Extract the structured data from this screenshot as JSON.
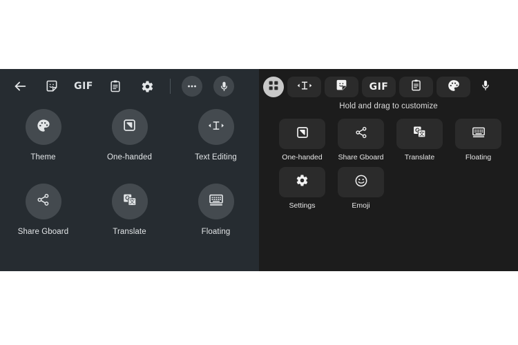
{
  "left_panel": {
    "background": "#262c31",
    "toolbar": {
      "items": [
        {
          "icon": "back-arrow-icon",
          "label": "Back"
        },
        {
          "icon": "sticker-icon",
          "label": "Stickers"
        },
        {
          "icon": "gif-icon",
          "label": "GIF"
        },
        {
          "icon": "clipboard-icon",
          "label": "Clipboard"
        },
        {
          "icon": "gear-icon",
          "label": "Settings"
        }
      ],
      "more_label": "More",
      "mic_label": "Voice input"
    },
    "grid": [
      {
        "icon": "palette-icon",
        "label": "Theme"
      },
      {
        "icon": "one-handed-icon",
        "label": "One-handed"
      },
      {
        "icon": "text-editing-icon",
        "label": "Text Editing"
      },
      {
        "icon": "share-icon",
        "label": "Share Gboard"
      },
      {
        "icon": "translate-icon",
        "label": "Translate"
      },
      {
        "icon": "floating-keyboard-icon",
        "label": "Floating"
      }
    ]
  },
  "right_panel": {
    "background": "#1c1c1c",
    "toolbar": {
      "active": {
        "icon": "grid-apps-icon",
        "label": "All apps"
      },
      "items": [
        {
          "icon": "text-editing-icon",
          "label": "Text Editing"
        },
        {
          "icon": "sticker-icon",
          "label": "Stickers"
        },
        {
          "icon": "gif-icon",
          "label": "GIF"
        },
        {
          "icon": "clipboard-icon",
          "label": "Clipboard"
        },
        {
          "icon": "palette-icon",
          "label": "Theme"
        }
      ],
      "mic_label": "Voice input"
    },
    "hint": "Hold and drag to customize",
    "grid": [
      {
        "icon": "one-handed-icon",
        "label": "One-handed"
      },
      {
        "icon": "share-icon",
        "label": "Share Gboard"
      },
      {
        "icon": "translate-icon",
        "label": "Translate"
      },
      {
        "icon": "floating-keyboard-icon",
        "label": "Floating"
      },
      {
        "icon": "gear-icon",
        "label": "Settings"
      },
      {
        "icon": "emoji-icon",
        "label": "Emoji"
      }
    ]
  },
  "colors": {
    "left_bg": "#262c31",
    "right_bg": "#1c1c1c",
    "left_circle": "#444a4f",
    "right_tile": "#2b2b2b",
    "active_chip": "#c9c9c9",
    "icon": "#e3e6e8",
    "page_bg": "#ffffff"
  }
}
